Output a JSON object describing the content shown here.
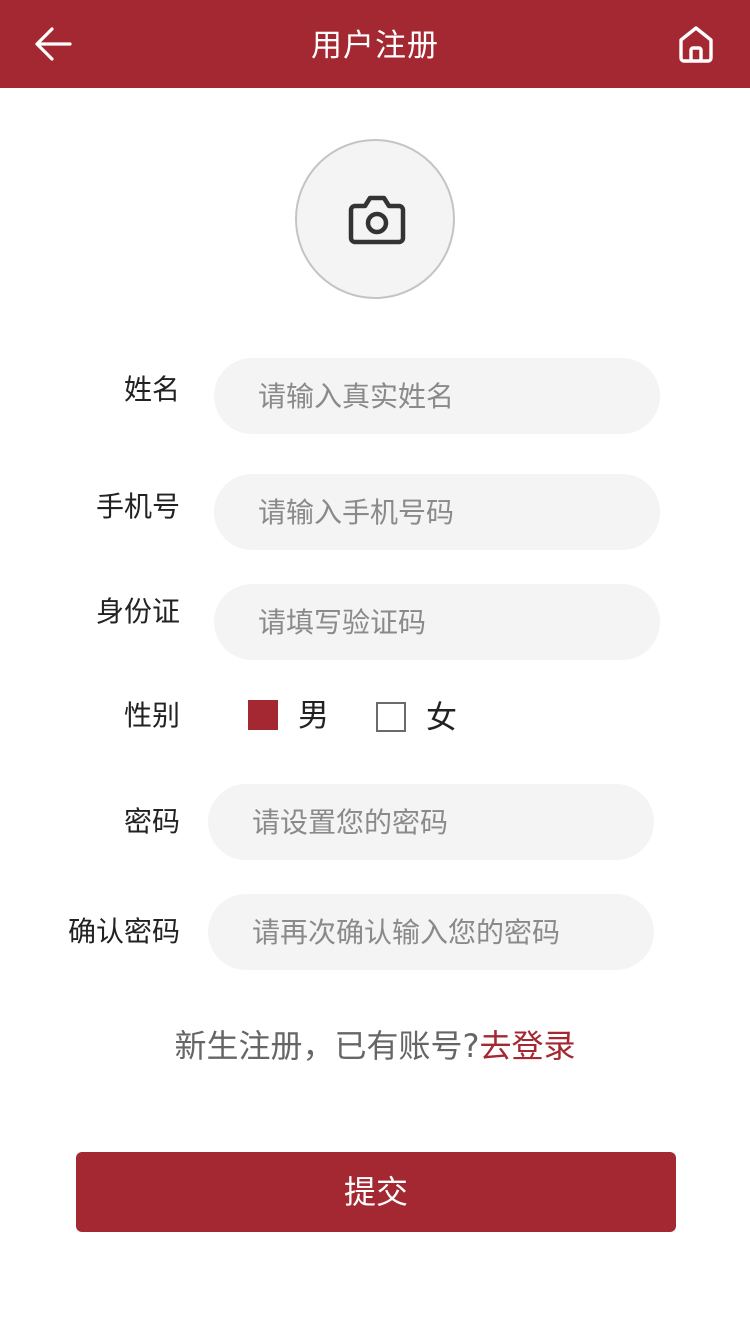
{
  "header": {
    "title": "用户注册",
    "back_icon": "back-arrow-icon",
    "home_icon": "home-icon"
  },
  "avatar": {
    "icon": "camera-icon"
  },
  "form": {
    "name": {
      "label": "姓名",
      "placeholder": "请输入真实姓名",
      "value": ""
    },
    "phone": {
      "label": "手机号",
      "placeholder": "请输入手机号码",
      "value": ""
    },
    "id_card": {
      "label": "身份证",
      "placeholder": "请填写验证码",
      "value": ""
    },
    "gender": {
      "label": "性别",
      "options": [
        {
          "label": "男",
          "checked": true
        },
        {
          "label": "女",
          "checked": false
        }
      ]
    },
    "password": {
      "label": "密码",
      "placeholder": "请设置您的密码",
      "value": ""
    },
    "confirm_password": {
      "label": "确认密码",
      "placeholder": "请再次确认输入您的密码",
      "value": ""
    }
  },
  "login_prompt": {
    "text": "新生注册，已有账号?",
    "link": "去登录"
  },
  "submit_label": "提交",
  "colors": {
    "brand": "#a32831",
    "input_bg": "#f4f4f4",
    "muted_text": "#666666",
    "placeholder": "#8a8a8a"
  }
}
